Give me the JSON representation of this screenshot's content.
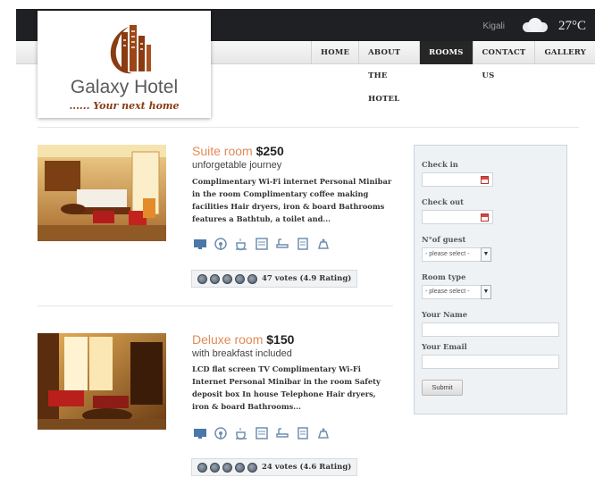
{
  "header": {
    "city": "Kigali",
    "temperature": "27°C",
    "weather_icon": "partly-cloudy-icon"
  },
  "nav": {
    "items": [
      {
        "label": "HOME",
        "active": false
      },
      {
        "label": "ABOUT THE HOTEL",
        "active": false
      },
      {
        "label": "ROOMS",
        "active": true
      },
      {
        "label": "CONTACT US",
        "active": false
      },
      {
        "label": "GALLERY",
        "active": false
      }
    ]
  },
  "brand": {
    "name": "Galaxy Hotel",
    "tagline": "...... Your next home",
    "colors": {
      "primary": "#8a3b12",
      "text": "#5a5a5a"
    }
  },
  "rooms": [
    {
      "name": "Suite room",
      "price": "$250",
      "subtitle": "unforgetable journey",
      "description": "Complimentary Wi-Fi internet Personal Minibar in the room Complimentary coffee making facilities Hair dryers, iron & board Bathrooms features a Bathtub, a toilet and...",
      "rating_text": "47 votes (4.9 Rating)",
      "stars": 5
    },
    {
      "name": "Deluxe room",
      "price": "$150",
      "subtitle": "with breakfast included",
      "description": "LCD flat screen TV Complimentary Wi-Fi Internet Personal Minibar in the room Safety deposit box In house Telephone Hair dryers, iron & board Bathrooms...",
      "rating_text": "24 votes (4.6 Rating)",
      "stars": 5
    }
  ],
  "amenity_icons": [
    "tv-icon",
    "wifi-icon",
    "coffee-icon",
    "minibar-icon",
    "bathtub-icon",
    "safe-icon",
    "service-icon"
  ],
  "booking": {
    "check_in_label": "Check in",
    "check_out_label": "Check out",
    "guests_label": "N°of guest",
    "guests_value": "- please select -",
    "room_type_label": "Room type",
    "room_type_value": "- please select -",
    "name_label": "Your Name",
    "email_label": "Your Email",
    "submit_label": "Submit"
  }
}
